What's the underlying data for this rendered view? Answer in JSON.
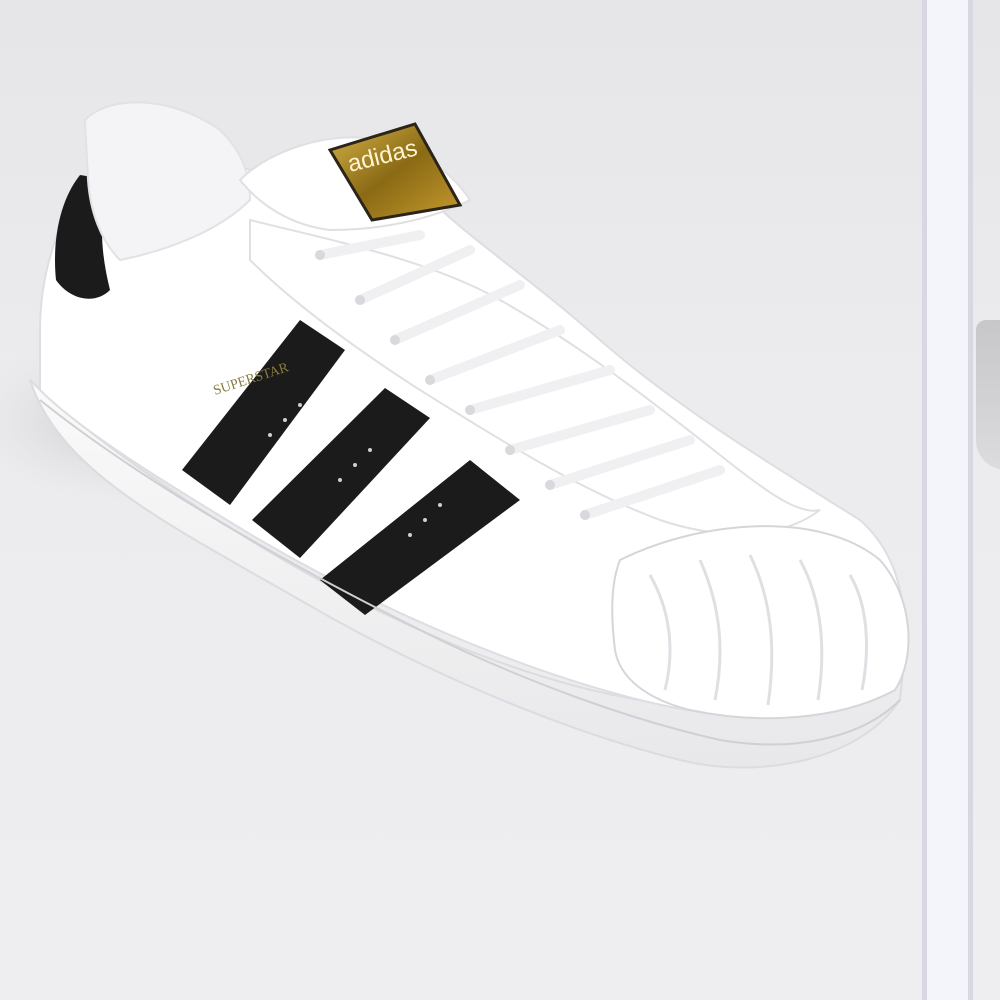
{
  "gallery": {
    "main_image": {
      "icon": "sneaker-image",
      "tongue_label_text": "adidas",
      "side_print_text": "SUPERSTAR",
      "colors": {
        "upper": "#ffffff",
        "stripes": "#1b1b1b",
        "heel_tab": "#1b1b1b",
        "tongue_label": "#a07e1c"
      }
    },
    "next_image": {
      "icon": "next-product-image"
    }
  }
}
